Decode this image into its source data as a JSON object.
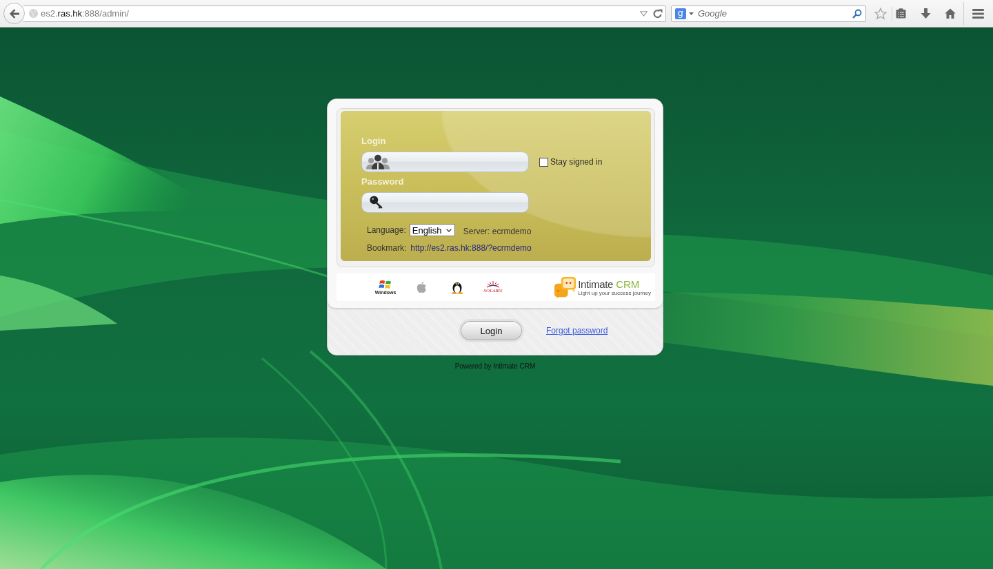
{
  "browser": {
    "url": "es2.**ras.hk**:888/admin/",
    "search": {
      "engine_letter": "g",
      "placeholder": "Google"
    }
  },
  "login_form": {
    "login_label": "Login",
    "stay_signed_in": {
      "label": "Stay signed in",
      "checked": false
    },
    "password_label": "Password",
    "language": {
      "label": "Language:",
      "value": "English"
    },
    "server": "Server: ecrmdemo",
    "bookmark": {
      "label": "Bookmark:",
      "url": "http://es2.ras.hk:888/?ecrmdemo"
    }
  },
  "platforms": [
    {
      "kind": "windows",
      "caption": "Windows"
    },
    {
      "kind": "apple"
    },
    {
      "kind": "linux"
    },
    {
      "kind": "solaris",
      "caption": "SOLARIS"
    }
  ],
  "brand": {
    "name": "Intimate",
    "suffix": "CRM",
    "tagline": "Light up your success journey"
  },
  "actions": {
    "login_button": "Login",
    "forgot_link": "Forgot password"
  },
  "footer": "Powered by Intimate CRM"
}
